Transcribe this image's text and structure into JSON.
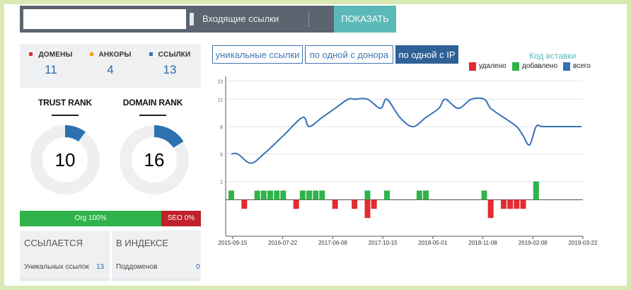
{
  "search": {
    "url_value": "",
    "mode_label": "Входящие ссылки",
    "show_button": "ПОКАЗАТЬ"
  },
  "stats": {
    "items": [
      {
        "label": "ДОМЕНЫ",
        "value": "11",
        "color": "#e22b32"
      },
      {
        "label": "АНКОРЫ",
        "value": "4",
        "color": "#f2a12a"
      },
      {
        "label": "ССЫЛКИ",
        "value": "13",
        "color": "#3572b7"
      }
    ]
  },
  "ranks": {
    "trust": {
      "title": "TRUST RANK",
      "value": "10",
      "fraction": 0.1
    },
    "domain": {
      "title": "DOMAIN RANK",
      "value": "16",
      "fraction": 0.16
    }
  },
  "split": {
    "org_label": "Org 100%",
    "seo_label": "SEO 0%",
    "org_color": "#2fb34a",
    "seo_color": "#c0212a"
  },
  "links_table": {
    "header": "ССЫЛАЕТСЯ",
    "row_label": "Уникальных ссылок",
    "row_value": "13"
  },
  "index_table": {
    "header": "В ИНДЕКСЕ",
    "row_label": "Поддоменов",
    "row_value": "0"
  },
  "chart_tabs": [
    {
      "label": "уникальные ссылки",
      "active": false
    },
    {
      "label": "по одной с донора",
      "active": false
    },
    {
      "label": "по одной с IP",
      "active": true
    }
  ],
  "embed_link": "Код вставки",
  "legend": [
    {
      "label": "удалено",
      "color": "#e22b32"
    },
    {
      "label": "добавлено",
      "color": "#2fb34a"
    },
    {
      "label": "всего",
      "color": "#3572b7"
    }
  ],
  "chart_data": {
    "type": "line",
    "title": "",
    "y_ticks": [
      2,
      5,
      8,
      11,
      13
    ],
    "ylim": [
      -4,
      13.5
    ],
    "x_tick_labels": [
      "2015-09-15",
      "2016-07-22",
      "2017-06-08",
      "2017-10-15",
      "2018-05-01",
      "2018-11-08",
      "2019-02-08",
      "2019-03-22"
    ],
    "grid": true,
    "series": [
      {
        "name": "всего",
        "type": "line",
        "color": "#3572b7",
        "points": [
          [
            0,
            5
          ],
          [
            1,
            5
          ],
          [
            3,
            4
          ],
          [
            5,
            5
          ],
          [
            8,
            7
          ],
          [
            11,
            9
          ],
          [
            12,
            8
          ],
          [
            14,
            9
          ],
          [
            16,
            10
          ],
          [
            18,
            11
          ],
          [
            19,
            11
          ],
          [
            21,
            11
          ],
          [
            23,
            10
          ],
          [
            24,
            11
          ],
          [
            26,
            9
          ],
          [
            28,
            8
          ],
          [
            30,
            9
          ],
          [
            32,
            10
          ],
          [
            33,
            11
          ],
          [
            35,
            10
          ],
          [
            37,
            11
          ],
          [
            39,
            11
          ],
          [
            40,
            10
          ],
          [
            42,
            9
          ],
          [
            44,
            8
          ],
          [
            45,
            7
          ],
          [
            46,
            6
          ],
          [
            47,
            8
          ],
          [
            48,
            8
          ],
          [
            50,
            8
          ],
          [
            52,
            8
          ],
          [
            54,
            8
          ]
        ]
      },
      {
        "name": "добавлено",
        "type": "bar",
        "color": "#2fb34a",
        "values": [
          [
            0,
            1
          ],
          [
            4,
            1
          ],
          [
            5,
            1
          ],
          [
            6,
            1
          ],
          [
            7,
            1
          ],
          [
            8,
            1
          ],
          [
            11,
            1
          ],
          [
            12,
            1
          ],
          [
            13,
            1
          ],
          [
            14,
            1
          ],
          [
            21,
            1
          ],
          [
            24,
            1
          ],
          [
            29,
            1
          ],
          [
            30,
            1
          ],
          [
            39,
            1
          ],
          [
            47,
            2
          ]
        ]
      },
      {
        "name": "удалено",
        "type": "bar",
        "color": "#e22b32",
        "values": [
          [
            2,
            -1
          ],
          [
            10,
            -1
          ],
          [
            16,
            -1
          ],
          [
            19,
            -1
          ],
          [
            21,
            -2
          ],
          [
            22,
            -1
          ],
          [
            40,
            -2
          ],
          [
            42,
            -1
          ],
          [
            43,
            -1
          ],
          [
            44,
            -1
          ],
          [
            45,
            -1
          ]
        ]
      }
    ]
  }
}
